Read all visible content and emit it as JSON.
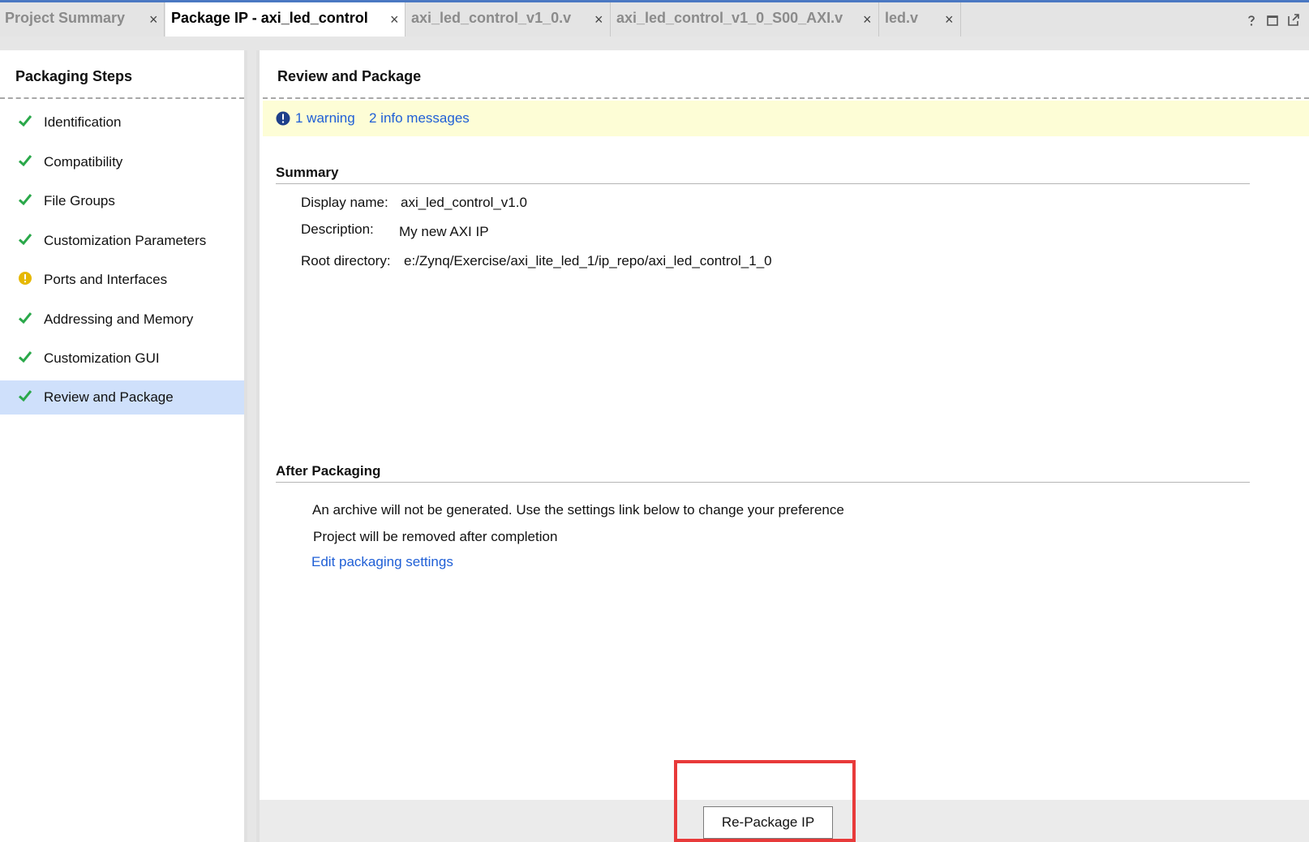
{
  "tabs": [
    {
      "label": "Project Summary",
      "active": false
    },
    {
      "label": "Package IP - axi_led_control",
      "active": true
    },
    {
      "label": "axi_led_control_v1_0.v",
      "active": false
    },
    {
      "label": "axi_led_control_v1_0_S00_AXI.v",
      "active": false
    },
    {
      "label": "led.v",
      "active": false
    }
  ],
  "tab_close_glyph": "×",
  "window_icons": [
    "help-icon",
    "restore-icon",
    "maximize-icon"
  ],
  "left_panel": {
    "title": "Packaging Steps",
    "steps": [
      {
        "label": "Identification",
        "status": "check-icon"
      },
      {
        "label": "Compatibility",
        "status": "check-icon"
      },
      {
        "label": "File Groups",
        "status": "check-icon"
      },
      {
        "label": "Customization Parameters",
        "status": "check-icon"
      },
      {
        "label": "Ports and Interfaces",
        "status": "warning-icon"
      },
      {
        "label": "Addressing and Memory",
        "status": "check-icon"
      },
      {
        "label": "Customization GUI",
        "status": "check-icon"
      },
      {
        "label": "Review and Package",
        "status": "check-icon",
        "selected": true
      }
    ]
  },
  "main": {
    "title": "Review and Package",
    "messages": {
      "warning_link": "1 warning",
      "info_link": "2 info messages"
    },
    "summary": {
      "title": "Summary",
      "display_name_label": "Display name:",
      "display_name_value": "axi_led_control_v1.0",
      "description_label": "Description:",
      "description_value": "My new AXI IP",
      "root_dir_label": "Root directory:",
      "root_dir_value": "e:/Zynq/Exercise/axi_lite_led_1/ip_repo/axi_led_control_1_0"
    },
    "after_packaging": {
      "title": "After Packaging",
      "line1": "An archive will not be generated. Use the settings link below to change your preference",
      "line2": "Project will be removed after completion",
      "settings_link": "Edit packaging settings"
    },
    "repackage_button": "Re-Package IP"
  },
  "colors": {
    "accent_link": "#1f5fd6",
    "check": "#2aa84a",
    "warning": "#e6b800",
    "highlight": "#e83a3a",
    "selected_row": "#cfe0fb",
    "message_bar": "#fdfdd6"
  }
}
